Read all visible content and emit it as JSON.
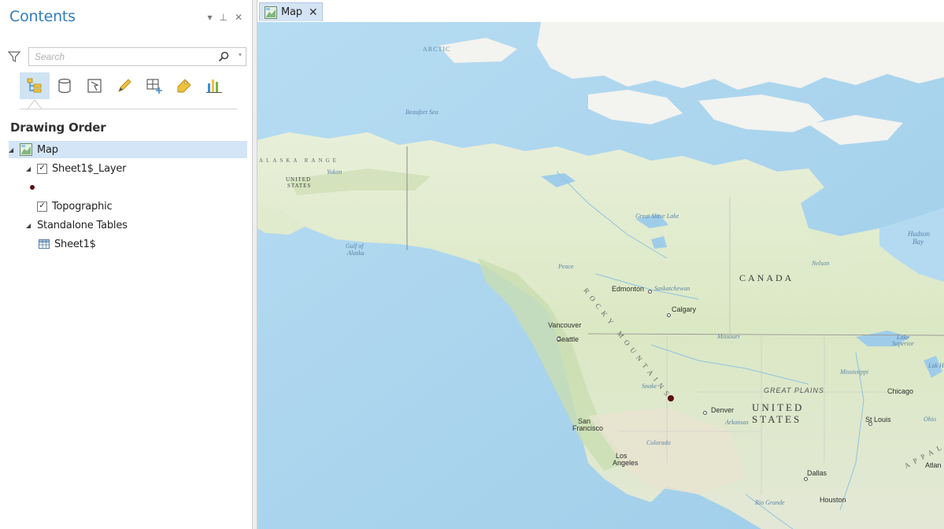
{
  "contents_pane": {
    "title": "Contents",
    "controls": {
      "dropdown": "▾",
      "pin": "⊥",
      "close": "✕"
    },
    "search": {
      "placeholder": "Search",
      "value": ""
    },
    "toolbar_icons": [
      "list-by-drawing-order-icon",
      "list-by-data-source-icon",
      "list-by-selection-icon",
      "list-by-editing-icon",
      "list-by-snapping-icon",
      "list-by-labeling-icon",
      "list-by-charts-icon"
    ],
    "section_title": "Drawing Order",
    "tree": {
      "map": "Map",
      "layer": "Sheet1$_Layer",
      "basemap": "Topographic",
      "standalone": "Standalone Tables",
      "table": "Sheet1$"
    }
  },
  "map_view": {
    "tab_label": "Map",
    "tab_close": "✕",
    "labels": {
      "canada": "CANADA",
      "united": "UNITED",
      "states": "STATES",
      "united_small": "UNITED",
      "states_small": "STATES",
      "great_plains": "GREAT PLAINS",
      "rocky": "ROCKY MOUNTAINS",
      "alaska_range": "ALASKA RANGE",
      "appalachian": "APPALAC",
      "edmonton": "Edmonton",
      "calgary": "Calgary",
      "vancouver": "Vancouver",
      "seattle": "Seattle",
      "denver": "Denver",
      "san_francisco_1": "San",
      "san_francisco_2": "Francisco",
      "los_angeles_1": "Los",
      "los_angeles_2": "Angeles",
      "dallas": "Dallas",
      "houston": "Houston",
      "st_louis": "St Louis",
      "chicago": "Chicago",
      "atlanta": "Atlan",
      "hudson_bay_1": "Hudson",
      "hudson_bay_2": "Bay",
      "gulf_alaska_1": "Gulf of",
      "gulf_alaska_2": "Alaska",
      "missouri": "Missouri",
      "peace": "Peace",
      "saskatchewan": "Saskatchewan",
      "nelson": "Nelson",
      "snake": "Snake",
      "arkansas": "Arkansas",
      "colorado": "Colorado",
      "rio_grande": "Rio Grande",
      "mississippi": "Mississippi",
      "ohio": "Ohio",
      "lake_superior_1": "Lake",
      "lake_superior_2": "Superior",
      "great_slave": "Great Slave Lake",
      "beaufort": "Beaufort Sea",
      "arctic": "ARCTIC",
      "yukon": "Yukon",
      "lake_hur": "Lak Hur"
    },
    "colors": {
      "ocean": "#a9d4ef",
      "land": "#dce9c8",
      "arctic_land": "#f2f2ee",
      "point": "#5a0f14"
    }
  }
}
